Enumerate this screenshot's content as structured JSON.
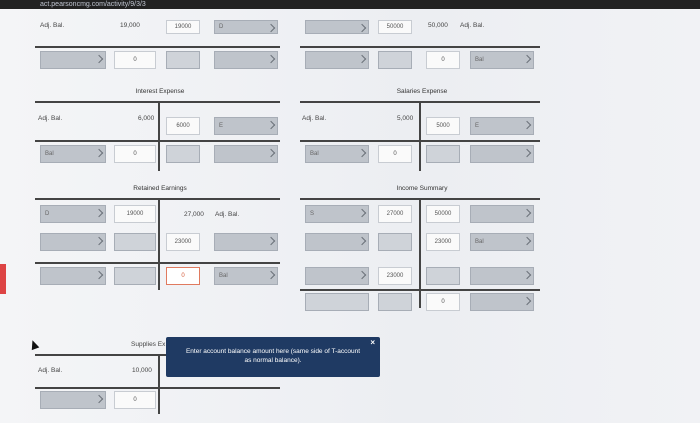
{
  "browser": {
    "url": "act.pearsoncmg.com/activity/9/3/3"
  },
  "top_account": {
    "label_left": "Adj. Bal.",
    "balance_left": "19,000",
    "input_left": "19000",
    "input_left2": "D",
    "input_right": "50000",
    "balance_right": "50,000",
    "label_right": "Adj. Bal.",
    "row2_left_value": "0",
    "row2_right_value": "0",
    "row2_right_dd": "Bal"
  },
  "interest_expense": {
    "title": "Interest Expense",
    "adj_label": "Adj. Bal.",
    "balance": "6,000",
    "input_value": "6000",
    "input_dc": "E",
    "row2_dd": "Bal",
    "row2_value": "0"
  },
  "salaries_expense": {
    "title": "Salaries Expense",
    "adj_label": "Adj. Bal.",
    "balance": "5,000",
    "input_value": "5000",
    "input_dc": "E",
    "row2_dd": "Bal",
    "row2_value": "0"
  },
  "retained_earnings": {
    "title": "Retained Earnings",
    "left_dd": "D",
    "left_value": "19000",
    "balance": "27,000",
    "adj_label": "Adj. Bal.",
    "right_value": "23000",
    "right_input": "0",
    "right_dd": "Bal"
  },
  "income_summary": {
    "title": "Income Summary",
    "left_dd": "S",
    "left_value": "27000",
    "left_value2": "23000",
    "right_value": "50000",
    "right_value2": "23000",
    "right_dd2": "Bal",
    "bottom_value": "0"
  },
  "supplies_expense": {
    "title": "Supplies Ex",
    "adj_label": "Adj. Bal.",
    "balance": "10,000",
    "row2_value": "0"
  },
  "tooltip": {
    "text_line1": "Enter account balance amount here (same side of T-account",
    "text_line2": "as normal balance).",
    "close": "×"
  }
}
